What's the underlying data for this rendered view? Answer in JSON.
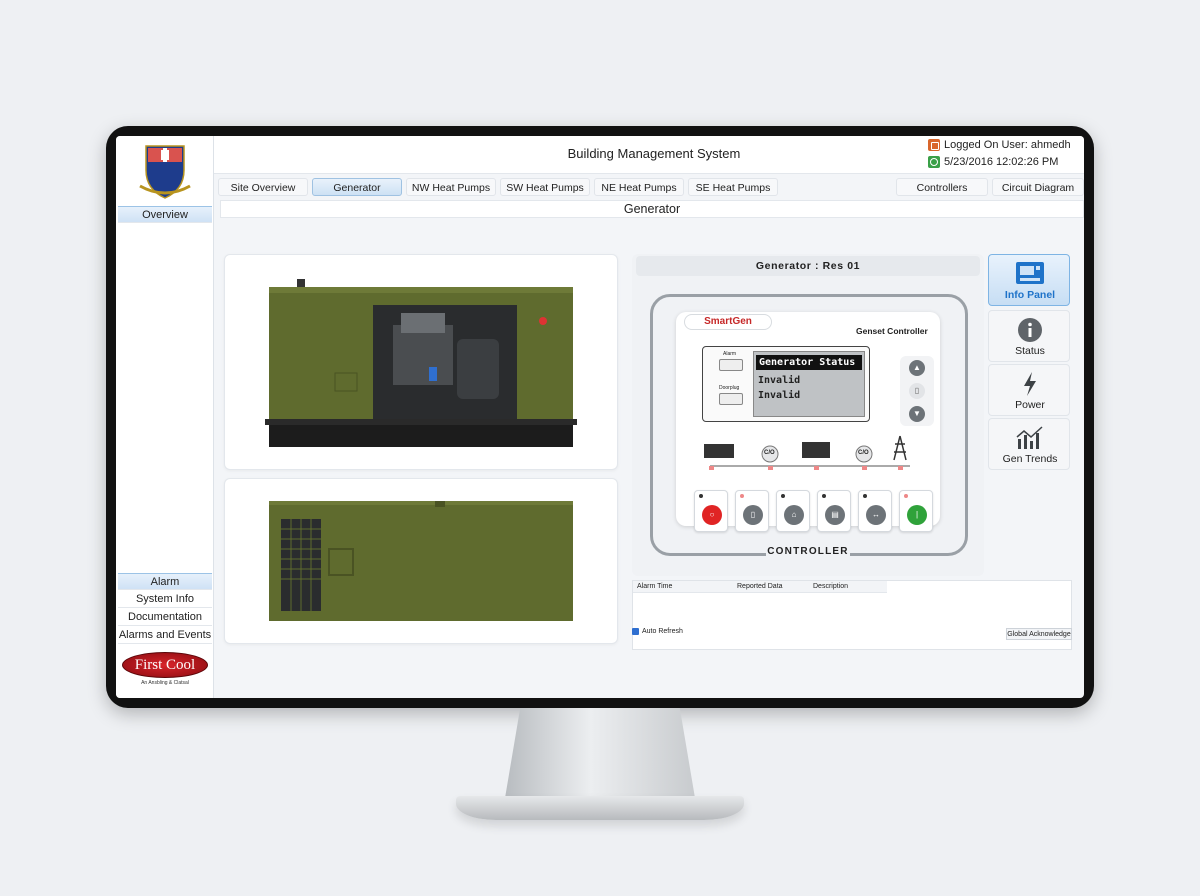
{
  "header": {
    "title": "Building Management System",
    "logged_on": "Logged On User: ahmedh",
    "datetime": "5/23/2016 12:02:26 PM"
  },
  "sidebar": {
    "top_item": "Overview",
    "bottom_items": [
      "Alarm Management",
      "System Info",
      "Documentation",
      "Alarms and Events"
    ],
    "brand_name": "First Cool",
    "brand_tagline": "An Ansbling & Clatsal"
  },
  "tabs": [
    {
      "label": "Site Overview"
    },
    {
      "label": "Generator"
    },
    {
      "label": "NW Heat Pumps"
    },
    {
      "label": "SW Heat Pumps"
    },
    {
      "label": "NE Heat Pumps"
    },
    {
      "label": "SE Heat Pumps"
    },
    {
      "label": "Controllers"
    },
    {
      "label": "Circuit Diagram"
    }
  ],
  "page_title": "Generator",
  "controller": {
    "title": "Generator : Res 01",
    "brand": "SmartGen",
    "model_label": "Genset Controller",
    "lcd_lines": [
      "Generator Status",
      "Invalid",
      "Invalid"
    ],
    "key_labels": [
      "Alarm",
      "Doorplug"
    ],
    "breaker_labels": [
      "C/O",
      "C/O"
    ],
    "frame_label": "CONTROLLER"
  },
  "side_buttons": [
    {
      "label": "Info Panel",
      "icon": "info-panel-icon"
    },
    {
      "label": "Status",
      "icon": "info-icon"
    },
    {
      "label": "Power",
      "icon": "lightning-icon"
    },
    {
      "label": "Gen Trends",
      "icon": "trend-chart-icon"
    }
  ],
  "alarm_table": {
    "columns": [
      "Alarm Time",
      "Reported Data",
      "Description"
    ],
    "auto_refresh_label": "Auto Refresh",
    "auto_refresh_checked": true,
    "ack_label": "Global Acknowledge"
  },
  "colors": {
    "accent": "#1f73c9",
    "generator_body": "#5f6b2e",
    "stop_button": "#e02424",
    "start_button": "#2fa23a"
  }
}
